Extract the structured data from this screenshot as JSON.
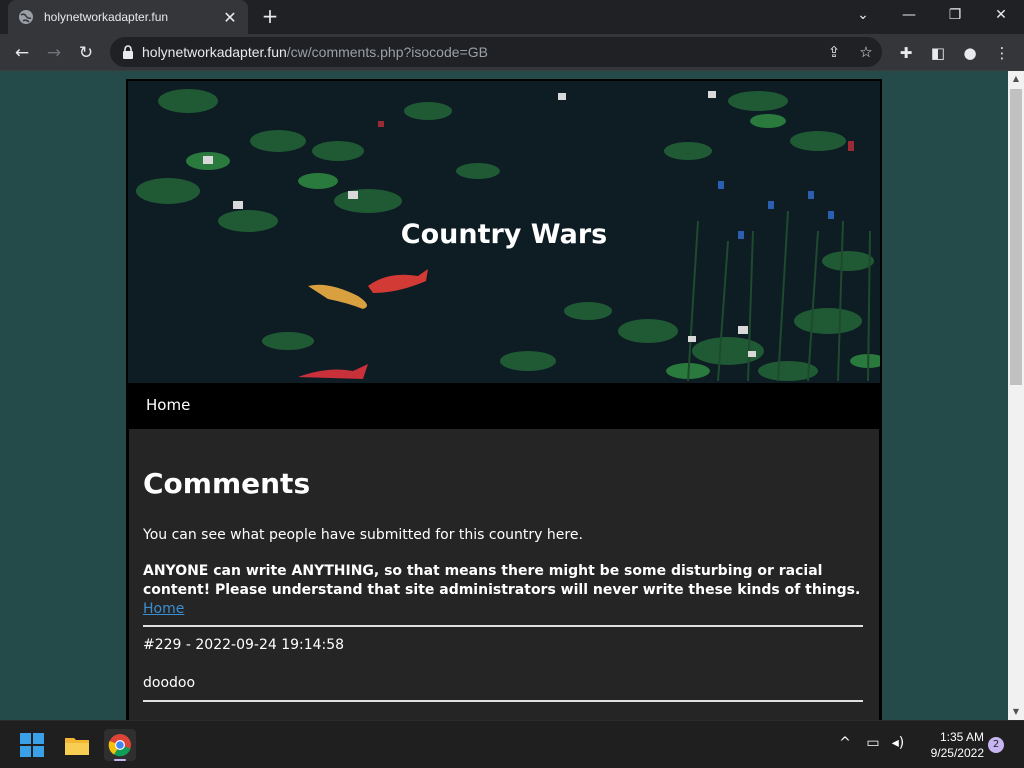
{
  "browser": {
    "tab_title": "holynetworkadapter.fun",
    "url_host": "holynetworkadapter.fun",
    "url_path": "/cw/comments.php?isocode=GB"
  },
  "site": {
    "title": "Country Wars",
    "nav_home": "Home"
  },
  "content": {
    "heading": "Comments",
    "intro": "You can see what people have submitted for this country here.",
    "warning": "ANYONE can write ANYTHING, so that means there might be some disturbing or racial content! Please understand that site administrators will never write these kinds of things.",
    "home_link": "Home",
    "comments": [
      {
        "meta": "#229 - 2022-09-24 19:14:58",
        "text": "doodoo"
      }
    ]
  },
  "taskbar": {
    "time": "1:35 AM",
    "date": "9/25/2022",
    "notifications": "2"
  }
}
